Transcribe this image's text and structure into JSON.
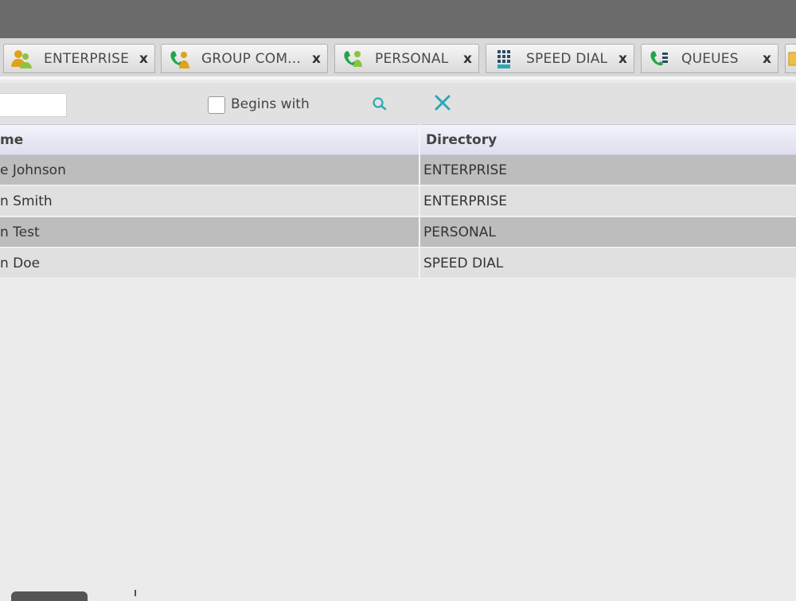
{
  "tabs": [
    {
      "label": "ENTERPRISE",
      "icon": "enterprise-icon",
      "close": "x"
    },
    {
      "label": "GROUP COM...",
      "icon": "group-common-icon",
      "close": "x"
    },
    {
      "label": "PERSONAL",
      "icon": "personal-icon",
      "close": "x"
    },
    {
      "label": "SPEED DIAL",
      "icon": "speed-dial-icon",
      "close": "x"
    },
    {
      "label": "QUEUES",
      "icon": "queues-icon",
      "close": "x"
    }
  ],
  "search": {
    "value": "",
    "begins_with_label": "Begins with",
    "begins_with_checked": false
  },
  "table": {
    "headers": [
      "me",
      "Directory"
    ],
    "rows": [
      {
        "name": "e Johnson",
        "directory": "ENTERPRISE"
      },
      {
        "name": "n Smith",
        "directory": "ENTERPRISE"
      },
      {
        "name": "n Test",
        "directory": "PERSONAL"
      },
      {
        "name": "n Doe",
        "directory": "SPEED DIAL"
      }
    ]
  },
  "colors": {
    "accent": "#2aa9b5",
    "row_dark": "#bdbdbd",
    "row_light": "#e0e0e0",
    "top_bar": "#6b6b6b"
  }
}
